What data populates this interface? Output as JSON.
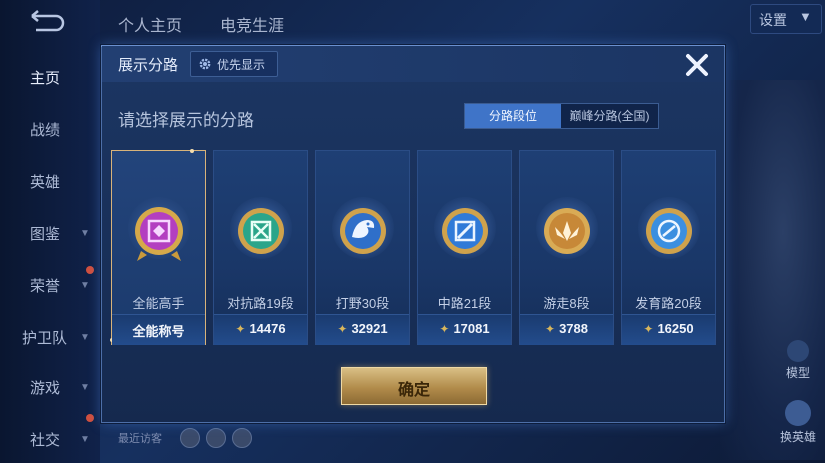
{
  "sidebar": {
    "items": [
      {
        "label": "主页",
        "chevron": false,
        "active": true
      },
      {
        "label": "战绩",
        "chevron": false
      },
      {
        "label": "英雄",
        "chevron": false
      },
      {
        "label": "图鉴",
        "chevron": true
      },
      {
        "label": "荣誉",
        "chevron": true
      },
      {
        "label": "护卫队",
        "chevron": true
      },
      {
        "label": "游戏",
        "chevron": true
      },
      {
        "label": "社交",
        "chevron": true
      }
    ]
  },
  "topbar": {
    "tabs": [
      "个人主页",
      "电竞生涯"
    ],
    "settings_label": "设置"
  },
  "right_panel": {
    "model_label": "模型",
    "switch_hero_label": "换英雄"
  },
  "recent_visitors_label": "最近访客",
  "dialog": {
    "title": "展示分路",
    "priority_button": "优先显示",
    "subtitle": "请选择展示的分路",
    "toggle": {
      "active": "分路段位",
      "inactive": "巅峰分路(全国)"
    },
    "cards": [
      {
        "name": "全能高手",
        "value": "全能称号",
        "selected": true,
        "emblem": "all-round-emblem-icon",
        "color": "#b33fc0"
      },
      {
        "name": "对抗路19段",
        "value": "14476",
        "emblem": "clash-lane-emblem-icon",
        "color": "#2aa58a"
      },
      {
        "name": "打野30段",
        "value": "32921",
        "emblem": "jungle-emblem-icon",
        "color": "#2f6fc9"
      },
      {
        "name": "中路21段",
        "value": "17081",
        "emblem": "mid-lane-emblem-icon",
        "color": "#2f7ad8"
      },
      {
        "name": "游走8段",
        "value": "3788",
        "emblem": "roam-emblem-icon",
        "color": "#c78838"
      },
      {
        "name": "发育路20段",
        "value": "16250",
        "emblem": "farm-lane-emblem-icon",
        "color": "#3b8fe0"
      }
    ],
    "confirm_label": "确定"
  },
  "colors": {
    "accent_blue": "#3f74c8",
    "gold": "#d8b65c",
    "selection_border": "#d8b37a"
  }
}
